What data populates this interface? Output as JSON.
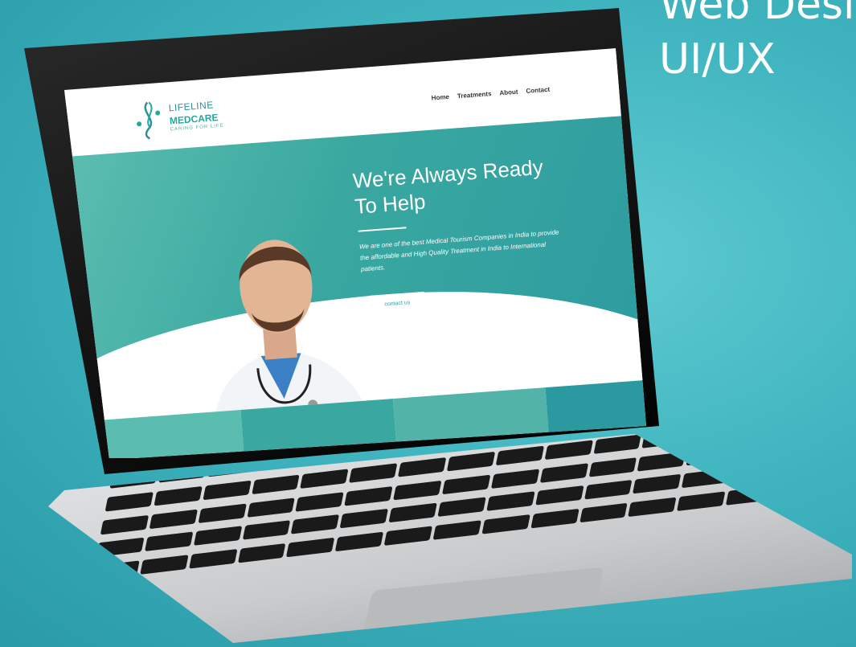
{
  "corner_title": {
    "line1": "Web Desi",
    "line2": "UI/UX"
  },
  "site": {
    "logo": {
      "line1": "LIFELINE",
      "line2": "MEDCARE",
      "tagline": "CARING FOR LIFE"
    },
    "nav": [
      "Home",
      "Treatments",
      "About",
      "Contact"
    ],
    "hero": {
      "title": "We're Always Ready To Help",
      "subtitle": "We are one of the best Medical Tourism Companies in India to provide the affordable and High Quality Treatment in India to International patients.",
      "button": "contact us"
    }
  },
  "colors": {
    "accent": "#3aa8a0",
    "background": "#3fb4bf"
  }
}
